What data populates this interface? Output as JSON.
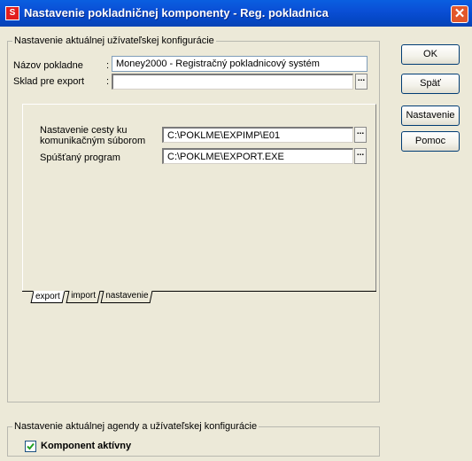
{
  "window": {
    "title": "Nastavenie pokladničnej komponenty - Reg. pokladnica",
    "close_label": "✕",
    "app_icon_glyph": "S"
  },
  "user_config": {
    "legend": "Nastavenie aktuálnej užívateľskej konfigurácie",
    "register_name_label": "Názov pokladne",
    "register_name_value": "Money2000 - Registračný pokladnicový systém",
    "stock_label": "Sklad  pre export",
    "stock_value": ""
  },
  "export_tab": {
    "path_label_line1": "Nastavenie cesty ku",
    "path_label_line2": "komunikačným súborom",
    "path_value": "C:\\POKLME\\EXPIMP\\E01",
    "program_label": "Spúšťaný program",
    "program_value": "C:\\POKLME\\EXPORT.EXE",
    "browse_label": "..."
  },
  "tabs": [
    {
      "label": "export",
      "active": true
    },
    {
      "label": "import",
      "active": false
    },
    {
      "label": "nastavenie",
      "active": false
    }
  ],
  "agenda_config": {
    "legend": "Nastavenie aktuálnej agendy a užívateľskej konfigurácie",
    "active_label": "Komponent aktívny",
    "active_checked": true
  },
  "buttons": {
    "ok": "OK",
    "back": "Späť",
    "settings": "Nastavenie",
    "help": "Pomoc"
  },
  "colors": {
    "titlebar": "#0a4fd6",
    "dialog_bg": "#ece9d8",
    "close": "#e2572b"
  }
}
